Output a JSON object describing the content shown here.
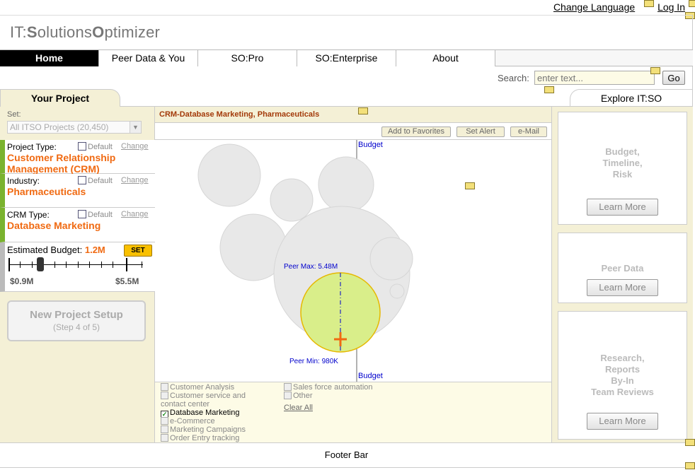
{
  "top_links": {
    "change_language": "Change Language",
    "log_in": "Log In"
  },
  "logo": {
    "part1": "IT:",
    "s": "S",
    "part2": "olutions",
    "o": "O",
    "part3": "ptimizer"
  },
  "nav": [
    "Home",
    "Peer Data & You",
    "SO:Pro",
    "SO:Enterprise",
    "About"
  ],
  "search": {
    "label": "Search:",
    "placeholder": "enter text...",
    "button": "Go"
  },
  "tabs": {
    "project": "Your Project",
    "explore": "Explore IT:SO"
  },
  "left": {
    "set_label": "Set:",
    "set_value": "All ITSO Projects (20,450)",
    "default_label": "Default",
    "change_label": "Change",
    "project_type": {
      "label": "Project Type:",
      "value_line1": "Customer Relationship",
      "value_line2": "Management (CRM)"
    },
    "industry": {
      "label": "Industry:",
      "value": "Pharmaceuticals"
    },
    "crm_type": {
      "label": "CRM Type:",
      "value": "Database Marketing"
    },
    "budget": {
      "label": "Estimated Budget:",
      "value": "1.2M",
      "set_button": "SET",
      "min": "$0.9M",
      "max": "$5.5M",
      "slider_fraction": 0.24
    },
    "new_project": {
      "title": "New Project Setup",
      "step": "(Step 4 of 5)"
    }
  },
  "center": {
    "title": "CRM-Database Marketing, Pharmaceuticals",
    "actions": [
      "Add to Favorites",
      "Set Alert",
      "e-Mail"
    ],
    "plot": {
      "top_axis_label": "Budget",
      "bottom_axis_label": "Budget",
      "peer_max": "Peer Max: 5.48M",
      "peer_min": "Peer Min: 980K"
    },
    "filters_col1": [
      {
        "label": "Customer Analysis",
        "checked": false
      },
      {
        "label": "Customer service and contact center",
        "checked": false
      },
      {
        "label": "Database Marketing",
        "checked": true
      },
      {
        "label": "e-Commerce",
        "checked": false
      },
      {
        "label": "Marketing Campaigns",
        "checked": false
      },
      {
        "label": "Order Entry tracking",
        "checked": false
      }
    ],
    "filters_col2": [
      {
        "label": "Sales force automation",
        "checked": false
      },
      {
        "label": "Other",
        "checked": false
      }
    ],
    "clear_all": "Clear All"
  },
  "right": {
    "learn_more": "Learn More",
    "boxes": [
      {
        "title_lines": [
          "Budget,",
          "Timeline,",
          "Risk"
        ]
      },
      {
        "title_lines": [
          "Peer Data"
        ]
      },
      {
        "title_lines": [
          "Research,",
          "Reports",
          "By-In",
          "Team Reviews"
        ]
      }
    ]
  },
  "footer": "Footer Bar",
  "colors": {
    "accent_orange": "#f06a12",
    "panel_beige": "#f4f0d6",
    "highlight_green": "#d9ee8a",
    "axis_blue": "#0000cc"
  }
}
